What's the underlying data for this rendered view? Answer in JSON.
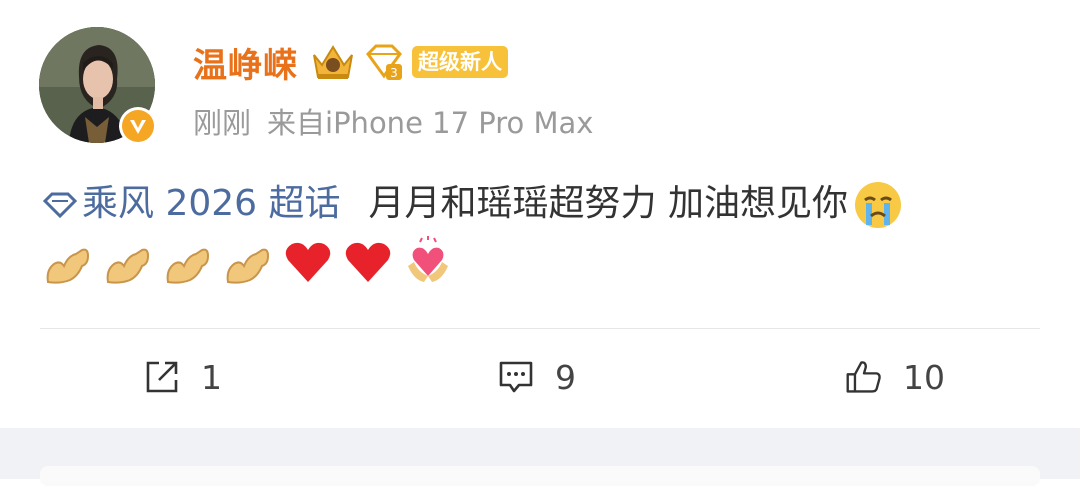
{
  "post": {
    "author": {
      "name": "温峥嵘",
      "badge": "超级新人"
    },
    "meta": {
      "time": "刚刚",
      "source": "来自iPhone 17 Pro Max"
    },
    "topic": "乘风 2026 超话",
    "text": "月月和瑶瑶超努力 加油想见你",
    "emojis": [
      "flexed-biceps-icon",
      "flexed-biceps-icon",
      "flexed-biceps-icon",
      "flexed-biceps-icon",
      "red-heart-icon",
      "red-heart-icon",
      "heart-hands-icon"
    ],
    "actions": {
      "repost_count": "1",
      "comment_count": "9",
      "like_count": "10"
    }
  },
  "colors": {
    "name": "#e8711a",
    "topic": "#4c6b9f",
    "badge": "#f7c13a",
    "meta": "#9a9a9a"
  }
}
